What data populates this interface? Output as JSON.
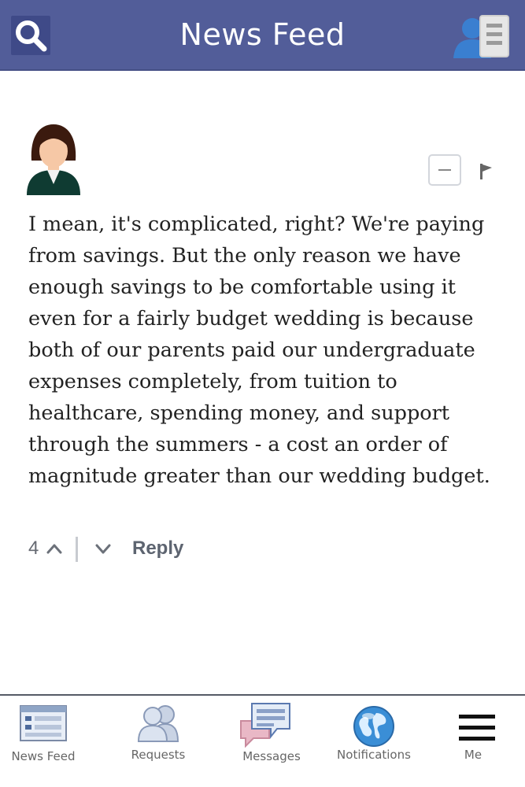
{
  "header": {
    "title": "News Feed",
    "search_icon": "search-icon",
    "profile_icon": "profile-list-icon",
    "color": "#525d99"
  },
  "post": {
    "avatar_icon": "user-avatar-icon",
    "collapse_icon": "minus-icon",
    "flag_icon": "flag-icon",
    "comment": "I mean, it's complicated, right? We're paying from savings. But the only reason we have enough savings to be comfortable using it even for a fairly budget wedding is because both of our parents paid our undergraduate expenses completely, from tuition to healthcare, spending money, and support through the summers - a cost an order of magnitude greater than our wedding budget.",
    "votes": "4",
    "reply_label": "Reply"
  },
  "bottom_nav": {
    "items": [
      {
        "label": "News Feed",
        "icon": "news-feed-icon"
      },
      {
        "label": "Requests",
        "icon": "friend-requests-icon"
      },
      {
        "label": "Messages",
        "icon": "messages-icon"
      },
      {
        "label": "Notifications",
        "icon": "globe-icon"
      },
      {
        "label": "Me",
        "icon": "menu-icon"
      }
    ]
  }
}
